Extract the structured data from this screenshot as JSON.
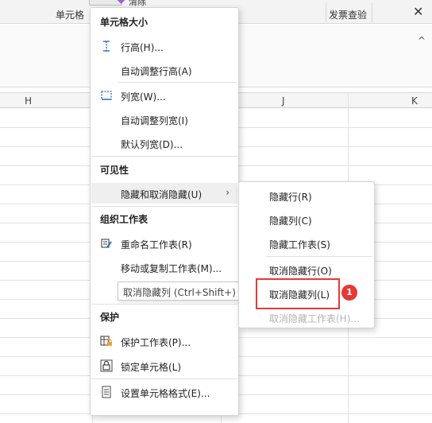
{
  "ribbon": {
    "cell_label": "单元格",
    "invoice_label": "发票查验",
    "clear_label": "清除",
    "close_glyph": "✕",
    "collapse_glyph": "^"
  },
  "columns": {
    "h": "H",
    "j": "J",
    "k": "K"
  },
  "menu": {
    "section_size": "单元格大小",
    "row_height": "行高(H)...",
    "autofit_row": "自动调整行高(A)",
    "col_width": "列宽(W)...",
    "autofit_col": "自动调整列宽(I)",
    "default_width": "默认列宽(D)...",
    "section_visibility": "可见性",
    "hide_unhide": "隐藏和取消隐藏(U)",
    "section_organize": "组织工作表",
    "rename_sheet": "重命名工作表(R)",
    "move_copy": "移动或复制工作表(M)...",
    "section_protect": "保护",
    "protect_sheet": "保护工作表(P)...",
    "lock_cell": "锁定单元格(L)",
    "format_cells": "设置单元格格式(E)..."
  },
  "submenu": {
    "hide_rows": "隐藏行(R)",
    "hide_cols": "隐藏列(C)",
    "hide_sheet": "隐藏工作表(S)",
    "unhide_rows": "取消隐藏行(O)",
    "unhide_cols": "取消隐藏列(L)",
    "unhide_sheet": "取消隐藏工作表(H)..."
  },
  "tooltip": "取消隐藏列 (Ctrl+Shift+) )",
  "badge": "1",
  "colors": {
    "highlight_red": "#e53935",
    "accent_blue": "#2a6fc9",
    "disabled_text": "#b5b5b5"
  }
}
